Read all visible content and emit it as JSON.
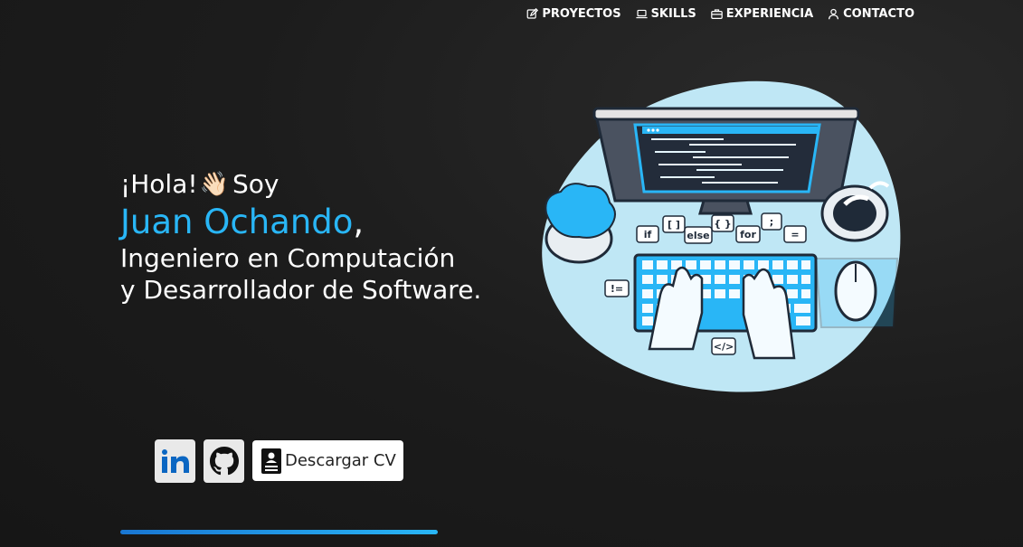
{
  "nav": [
    {
      "label": "PROYECTOS",
      "icon": "edit-icon"
    },
    {
      "label": "SKILLS",
      "icon": "laptop-icon"
    },
    {
      "label": "EXPERIENCIA",
      "icon": "briefcase-icon"
    },
    {
      "label": "CONTACTO",
      "icon": "user-icon"
    }
  ],
  "hero": {
    "greeting": "¡Hola!",
    "wave_emoji": "👋🏻",
    "soy": "Soy",
    "name": "Juan Ochando",
    "comma": ",",
    "role_line1": "Ingeniero en Computación",
    "role_line2": "y Desarrollador de Software."
  },
  "illustration": {
    "code_bubbles": [
      "if",
      "[ ]",
      "else",
      "{ }",
      "for",
      ";",
      "=",
      "!=",
      "</>"
    ]
  },
  "buttons": {
    "linkedin_icon": "linkedin-icon",
    "github_icon": "github-icon",
    "cv_label": "Descargar CV"
  },
  "colors": {
    "accent": "#29b6f6",
    "background": "#1c1c1c",
    "blob": "#bfe7f5"
  }
}
